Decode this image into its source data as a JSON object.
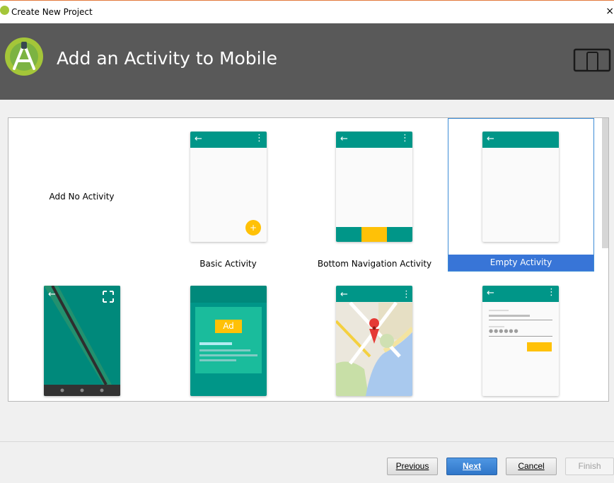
{
  "window": {
    "title": "Create New Project",
    "close_glyph": "×"
  },
  "header": {
    "title": "Add an Activity to Mobile",
    "logo_icon": "android-studio-icon",
    "device_icon": "tablet-phone-icon"
  },
  "gallery": {
    "items": [
      {
        "label": "Add No Activity",
        "selected": false
      },
      {
        "label": "Basic Activity",
        "selected": false
      },
      {
        "label": "Bottom Navigation Activity",
        "selected": false
      },
      {
        "label": "Empty Activity",
        "selected": true
      },
      {
        "label": "",
        "selected": false
      },
      {
        "label": "",
        "selected": false
      },
      {
        "label": "",
        "selected": false
      },
      {
        "label": "",
        "selected": false
      }
    ],
    "ad_label": "Ad",
    "fab_glyph": "+"
  },
  "footer": {
    "previous_label": "Previous",
    "next_label": "Next",
    "cancel_label": "Cancel",
    "finish_label": "Finish"
  },
  "colors": {
    "toolbar_teal": "#009688",
    "accent_yellow": "#ffc107",
    "selection_blue": "#3875d7",
    "banner_gray": "#595959"
  }
}
